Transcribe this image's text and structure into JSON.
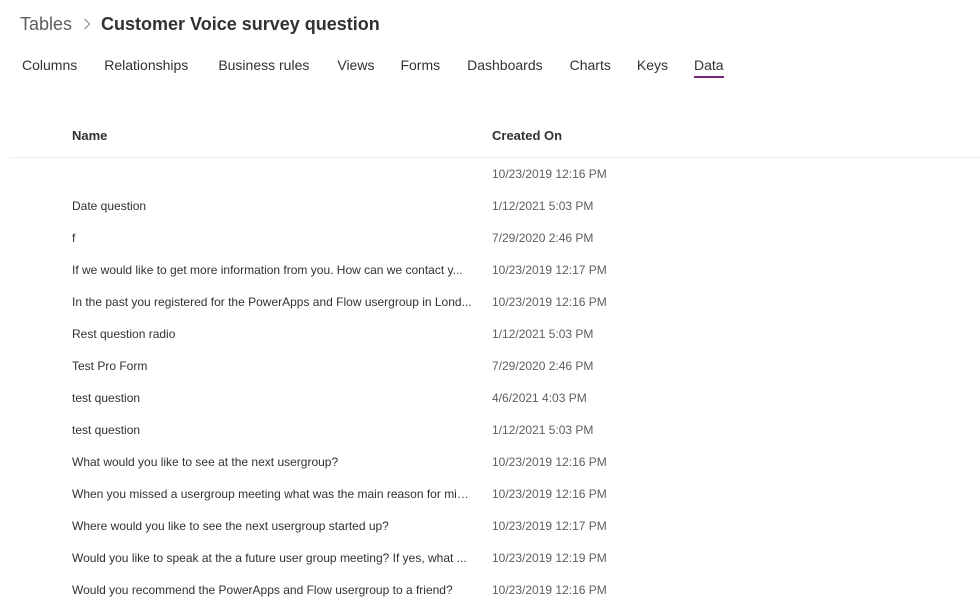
{
  "breadcrumb": {
    "root": "Tables",
    "current": "Customer Voice survey question"
  },
  "tabs": [
    {
      "label": "Columns",
      "active": false
    },
    {
      "label": "Relationships",
      "active": false
    },
    {
      "label": "Business rules",
      "active": false
    },
    {
      "label": "Views",
      "active": false
    },
    {
      "label": "Forms",
      "active": false
    },
    {
      "label": "Dashboards",
      "active": false
    },
    {
      "label": "Charts",
      "active": false
    },
    {
      "label": "Keys",
      "active": false
    },
    {
      "label": "Data",
      "active": true
    }
  ],
  "grid": {
    "columns": [
      "Name",
      "Created On"
    ],
    "rows": [
      {
        "name": "",
        "created_on": "10/23/2019 12:16 PM"
      },
      {
        "name": "Date question",
        "created_on": "1/12/2021 5:03 PM"
      },
      {
        "name": "f",
        "created_on": "7/29/2020 2:46 PM"
      },
      {
        "name": "If we would like to get more information from you. How can we contact y...",
        "created_on": "10/23/2019 12:17 PM"
      },
      {
        "name": "In the past you registered for the PowerApps and Flow usergroup in Lond...",
        "created_on": "10/23/2019 12:16 PM"
      },
      {
        "name": "Rest question radio",
        "created_on": "1/12/2021 5:03 PM"
      },
      {
        "name": "Test Pro Form",
        "created_on": "7/29/2020 2:46 PM"
      },
      {
        "name": "test question",
        "created_on": "4/6/2021 4:03 PM"
      },
      {
        "name": "test question",
        "created_on": "1/12/2021 5:03 PM"
      },
      {
        "name": "What would you like to see at the next usergroup?",
        "created_on": "10/23/2019 12:16 PM"
      },
      {
        "name": "When you missed a usergroup meeting what was the main reason for mis...",
        "created_on": "10/23/2019 12:16 PM"
      },
      {
        "name": "Where would you like to see the next usergroup started up?",
        "created_on": "10/23/2019 12:17 PM"
      },
      {
        "name": "Would you like to speak at the a future user group meeting? If yes, what ...",
        "created_on": "10/23/2019 12:19 PM"
      },
      {
        "name": "Would you recommend  the PowerApps and Flow usergroup to a friend?",
        "created_on": "10/23/2019 12:16 PM"
      }
    ]
  },
  "colors": {
    "accent": "#742774",
    "text": "#323130",
    "muted": "#605e5c",
    "divider": "#edebe9"
  }
}
